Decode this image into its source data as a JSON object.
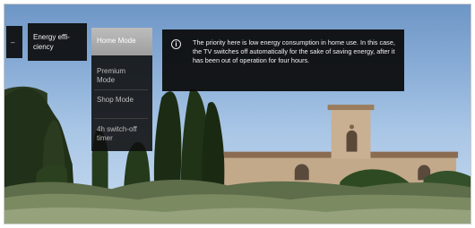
{
  "menu": {
    "left_stub": "–",
    "energy_efficiency_label": "Energy effi-\nciency",
    "options": [
      {
        "label": "Home Mode",
        "selected": true
      },
      {
        "label": "Premium Mode",
        "selected": false
      },
      {
        "label": "Shop Mode",
        "selected": false
      },
      {
        "label": "4h switch-off timer",
        "selected": false
      }
    ]
  },
  "info": {
    "icon": "info-icon",
    "text": "The priority here is low energy consumption in home use. In this case, the TV switches off automatically for the sake of saving energy, after it has been out of operation for four hours."
  },
  "colors": {
    "panel_bg": "#0c0c0c",
    "selected_bg": "#aeaeae",
    "text": "#ffffff",
    "muted_text": "#bdbdbd"
  }
}
